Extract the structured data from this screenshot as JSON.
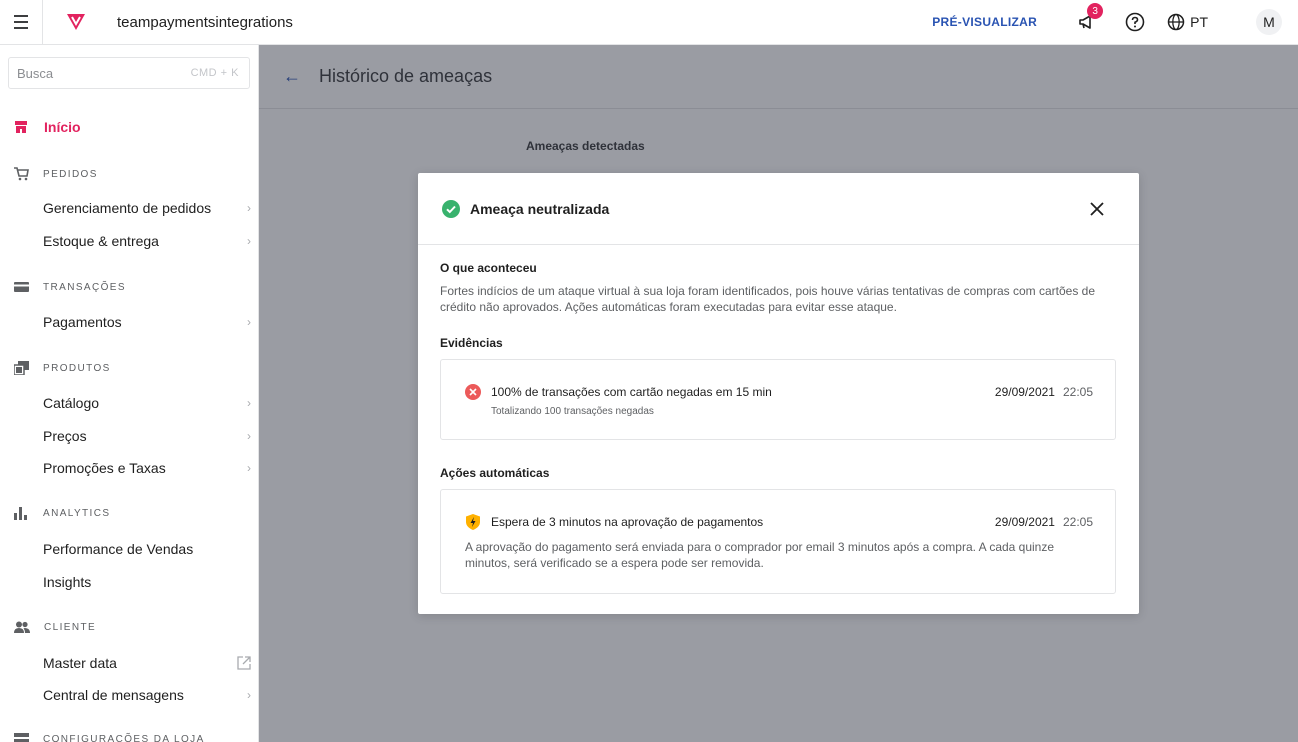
{
  "topbar": {
    "account": "teampayments​integrations",
    "preview": "PRÉ-VISUALIZAR",
    "notifications_count": "3",
    "language": "PT",
    "avatar_initial": "M"
  },
  "sidebar": {
    "search_placeholder": "Busca",
    "search_shortcut": "CMD + K",
    "home": "Início",
    "sections": [
      {
        "label": "PEDIDOS",
        "icon": "cart-icon",
        "items": [
          "Gerenciamento de pedidos",
          "Estoque & entrega"
        ]
      },
      {
        "label": "TRANSAÇÕES",
        "icon": "card-icon",
        "items": [
          "Pagamentos"
        ]
      },
      {
        "label": "PRODUTOS",
        "icon": "products-icon",
        "items": [
          "Catálogo",
          "Preços",
          "Promoções e Taxas"
        ]
      },
      {
        "label": "ANALYTICS",
        "icon": "chart-icon",
        "items": [
          "Performance de Vendas",
          "Insights"
        ]
      },
      {
        "label": "CLIENTE",
        "icon": "users-icon",
        "items": [
          "Master data",
          "Central de mensagens"
        ]
      },
      {
        "label": "CONFIGURAÇÕES DA LOJA",
        "icon": "store-icon",
        "items": []
      }
    ]
  },
  "main": {
    "title": "Histórico de ameaças",
    "threats_label": "Ameaças detectadas"
  },
  "modal": {
    "title": "Ameaça neutralizada",
    "what_title": "O que aconteceu",
    "what_text": "Fortes indícios de um ataque virtual à sua loja foram identificados, pois houve várias tentativas de compras com cartões de crédito não aprovados. Ações automáticas foram executadas para evitar esse ataque.",
    "evidence_title": "Evidências",
    "evidence": {
      "title": "100% de transações com cartão negadas em 15 min",
      "subtitle": "Totalizando 100 transações negadas",
      "date": "29/09/2021",
      "time": "22:05"
    },
    "actions_title": "Ações automáticas",
    "action": {
      "title": "Espera de 3 minutos na aprovação de pagamentos",
      "description": "A aprovação do pagamento será enviada para o comprador por email 3 minutos após a compra. A cada quinze minutos, será verificado se a espera pode ser removida.",
      "date": "29/09/2021",
      "time": "22:05"
    }
  },
  "colors": {
    "brand": "#e2235f",
    "link": "#2953b2",
    "success": "#38b26d",
    "danger": "#ec5a5a",
    "warning": "#ffb100"
  }
}
